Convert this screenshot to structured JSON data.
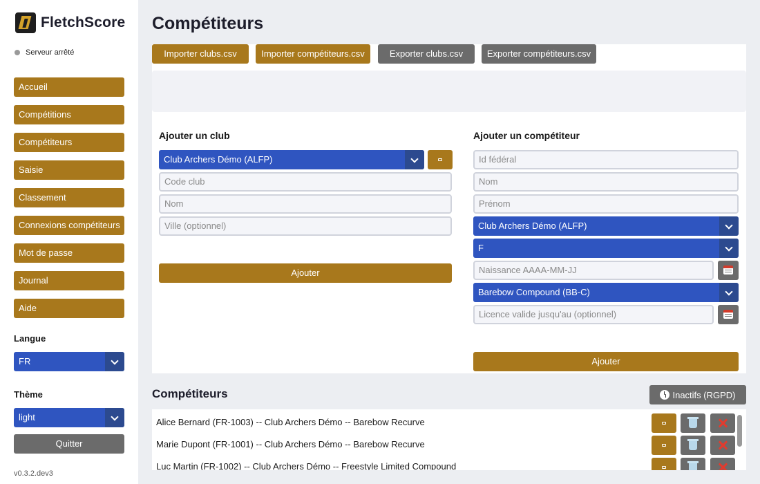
{
  "app": {
    "name": "FletchScore",
    "server_status": "Serveur arrêté",
    "version": "v0.3.2.dev3"
  },
  "sidebar": {
    "nav": [
      {
        "label": "Accueil"
      },
      {
        "label": "Compétitions"
      },
      {
        "label": "Compétiteurs"
      },
      {
        "label": "Saisie"
      },
      {
        "label": "Classement"
      },
      {
        "label": "Connexions compétiteurs"
      },
      {
        "label": "Mot de passe"
      },
      {
        "label": "Journal"
      },
      {
        "label": "Aide"
      }
    ],
    "language_label": "Langue",
    "language_value": "FR",
    "theme_label": "Thème",
    "theme_value": "light",
    "quit_label": "Quitter"
  },
  "page": {
    "title": "Compétiteurs"
  },
  "toolbar": {
    "import_clubs": "Importer clubs.csv",
    "import_competitors": "Importer compétiteurs.csv",
    "export_clubs": "Exporter clubs.csv",
    "export_competitors": "Exporter compétiteurs.csv"
  },
  "add_club": {
    "title": "Ajouter un club",
    "club_select": "Club Archers Démo (ALFP)",
    "code_placeholder": "Code club",
    "name_placeholder": "Nom",
    "city_placeholder": "Ville (optionnel)",
    "submit": "Ajouter"
  },
  "add_competitor": {
    "title": "Ajouter un compétiteur",
    "federal_id_placeholder": "Id fédéral",
    "last_name_placeholder": "Nom",
    "first_name_placeholder": "Prénom",
    "club_select": "Club Archers Démo (ALFP)",
    "gender_select": "F",
    "birth_placeholder": "Naissance AAAA-MM-JJ",
    "category_select": "Barebow Compound (BB-C)",
    "license_placeholder": "Licence valide jusqu'au (optionnel)",
    "submit": "Ajouter"
  },
  "competitors": {
    "title": "Compétiteurs",
    "inactive_button": "Inactifs (RGPD)",
    "rows": [
      {
        "text": "Alice Bernard (FR-1003) -- Club Archers Démo -- Barebow Recurve"
      },
      {
        "text": "Marie Dupont (FR-1001) -- Club Archers Démo -- Barebow Recurve"
      },
      {
        "text": "Luc Martin (FR-1002) -- Club Archers Démo -- Freestyle Limited Compound"
      }
    ]
  },
  "colors": {
    "gold": "#a8781c",
    "blue": "#2f55c0",
    "gray": "#6b6b6b",
    "background": "#eceef2"
  },
  "icons": [
    "logo-icon",
    "status-dot-icon",
    "chevron-down-icon",
    "pencil-icon",
    "calendar-icon",
    "clock-icon",
    "trash-icon",
    "close-icon"
  ]
}
